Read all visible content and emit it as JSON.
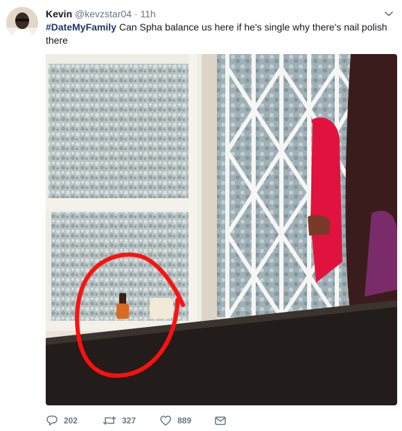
{
  "author": {
    "name": "Kevin",
    "handle": "@kevzstar04",
    "separator": "·",
    "time": "11h"
  },
  "tweet": {
    "hashtag": "#DateMyFamily",
    "body": " Can Spha balance us here if he's single why there's nail polish there"
  },
  "actions": {
    "replies": "202",
    "retweets": "327",
    "likes": "889"
  },
  "icons": {
    "more": "chevron-down-icon",
    "reply": "reply-icon",
    "retweet": "retweet-icon",
    "like": "heart-icon",
    "message": "envelope-icon"
  },
  "colors": {
    "hashtag": "#1c3a6b",
    "muted": "#657786",
    "annotation_circle": "#ff1010"
  }
}
